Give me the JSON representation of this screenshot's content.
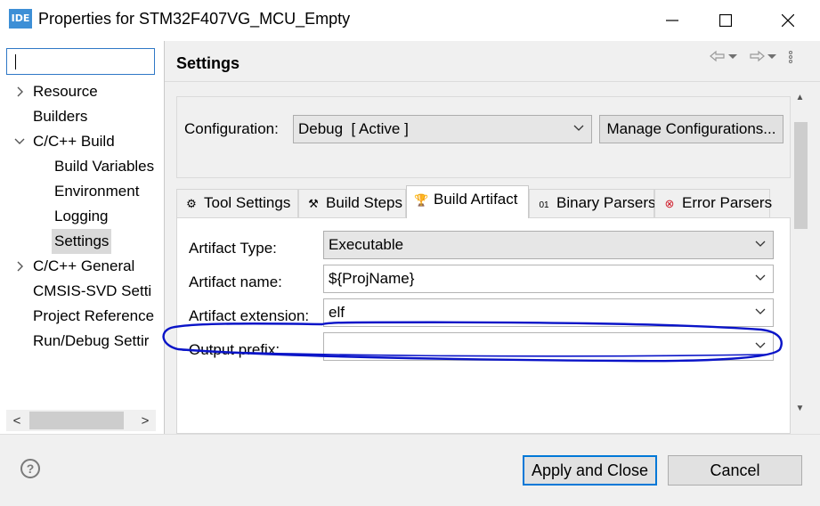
{
  "window": {
    "app_icon_text": "IDE",
    "title": "Properties for STM32F407VG_MCU_Empty",
    "minimize_icon": "minimize-icon",
    "maximize_icon": "maximize-icon",
    "close_icon": "close-icon"
  },
  "sidebar": {
    "filter_value": "",
    "items": [
      {
        "label": "Resource",
        "expander": "collapsed"
      },
      {
        "label": "Builders",
        "expander": "none"
      },
      {
        "label": "C/C++ Build",
        "expander": "expanded"
      },
      {
        "label": "Build Variables",
        "expander": "none"
      },
      {
        "label": "Environment",
        "expander": "none"
      },
      {
        "label": "Logging",
        "expander": "none"
      },
      {
        "label": "Settings",
        "expander": "none",
        "selected": true
      },
      {
        "label": "C/C++ General",
        "expander": "collapsed"
      },
      {
        "label": "CMSIS-SVD Setti",
        "expander": "none"
      },
      {
        "label": "Project Reference",
        "expander": "none"
      },
      {
        "label": "Run/Debug Settir",
        "expander": "none"
      }
    ],
    "scroll_left": "<",
    "scroll_right": ">"
  },
  "page": {
    "title": "Settings",
    "nav_icons": [
      "back-arrow-icon",
      "dropdown-icon",
      "forward-arrow-icon",
      "dropdown-icon",
      "view-menu-icon"
    ]
  },
  "configuration": {
    "label": "Configuration:",
    "value": "Debug  [ Active ]",
    "manage_button": "Manage Configurations..."
  },
  "tabs": [
    {
      "label": "Tool Settings",
      "icon": "tool-settings-icon"
    },
    {
      "label": "Build Steps",
      "icon": "build-steps-icon"
    },
    {
      "label": "Build Artifact",
      "icon": "trophy-icon",
      "active": true
    },
    {
      "label": "Binary Parsers",
      "icon": "binary-parsers-icon"
    },
    {
      "label": "Error Parsers",
      "icon": "error-parsers-icon"
    }
  ],
  "artifact": {
    "type_label": "Artifact Type:",
    "type_value": "Executable",
    "name_label": "Artifact name:",
    "name_value": "${ProjName}",
    "extension_label": "Artifact extension:",
    "extension_value": "elf",
    "prefix_label": "Output prefix:",
    "prefix_value": ""
  },
  "footer": {
    "help_label": "?",
    "apply_button": "Apply and Close",
    "cancel_button": "Cancel"
  },
  "colors": {
    "accent": "#0078d7",
    "annotation": "#0a14c8"
  }
}
